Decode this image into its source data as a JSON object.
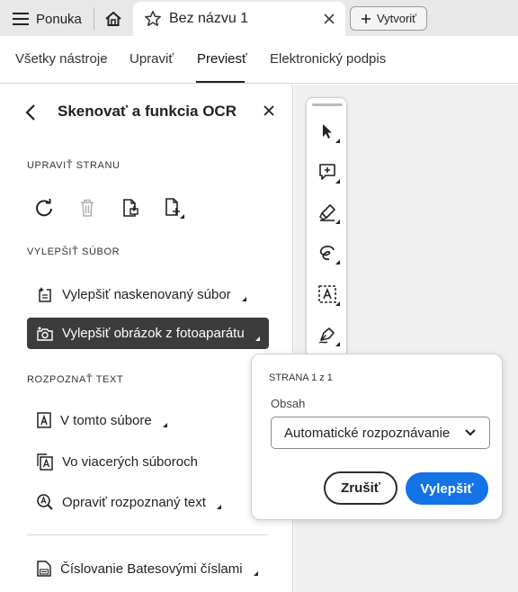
{
  "tabbar": {
    "menu_label": "Ponuka",
    "doc_tab_title": "Bez názvu 1",
    "create_label": "Vytvoriť"
  },
  "nav": {
    "items": [
      "Všetky nástroje",
      "Upraviť",
      "Previesť",
      "Elektronický podpis"
    ],
    "active": "Previesť"
  },
  "panel": {
    "title": "Skenovať a funkcia OCR",
    "sections": {
      "edit_page": "UPRAVIŤ STRANU",
      "enhance_file": "VYLEPŠIŤ SÚBOR",
      "recognize_text": "ROZPOZNAŤ TEXT"
    },
    "edit_page_icons": [
      "rotate-icon",
      "delete-icon",
      "extract-pages-icon",
      "insert-pages-icon"
    ],
    "items": {
      "enhance_scanned": "Vylepšiť naskenovaný súbor",
      "enhance_camera": "Vylepšiť obrázok z fotoaparátu",
      "in_this_file": "V tomto súbore",
      "in_multiple_files": "Vo viacerých súboroch",
      "correct_text": "Opraviť rozpoznaný text",
      "bates": "Číslovanie Batesovými číslami"
    },
    "selected_item": "enhance_camera"
  },
  "quick_tools": [
    "select-icon",
    "add-comment-icon",
    "highlight-icon",
    "draw-icon",
    "text-recognize-icon",
    "sign-icon"
  ],
  "popup": {
    "page_info": "STRANA 1 z 1",
    "content_label": "Obsah",
    "content_value": "Automatické rozpoznávanie",
    "cancel_label": "Zrušiť",
    "primary_label": "Vylepšiť"
  },
  "colors": {
    "accent": "#1473e6",
    "selected_bg": "#3c3c3c",
    "tabbar_bg": "#e8e8e8",
    "canvas_bg": "#f0f0f0"
  }
}
